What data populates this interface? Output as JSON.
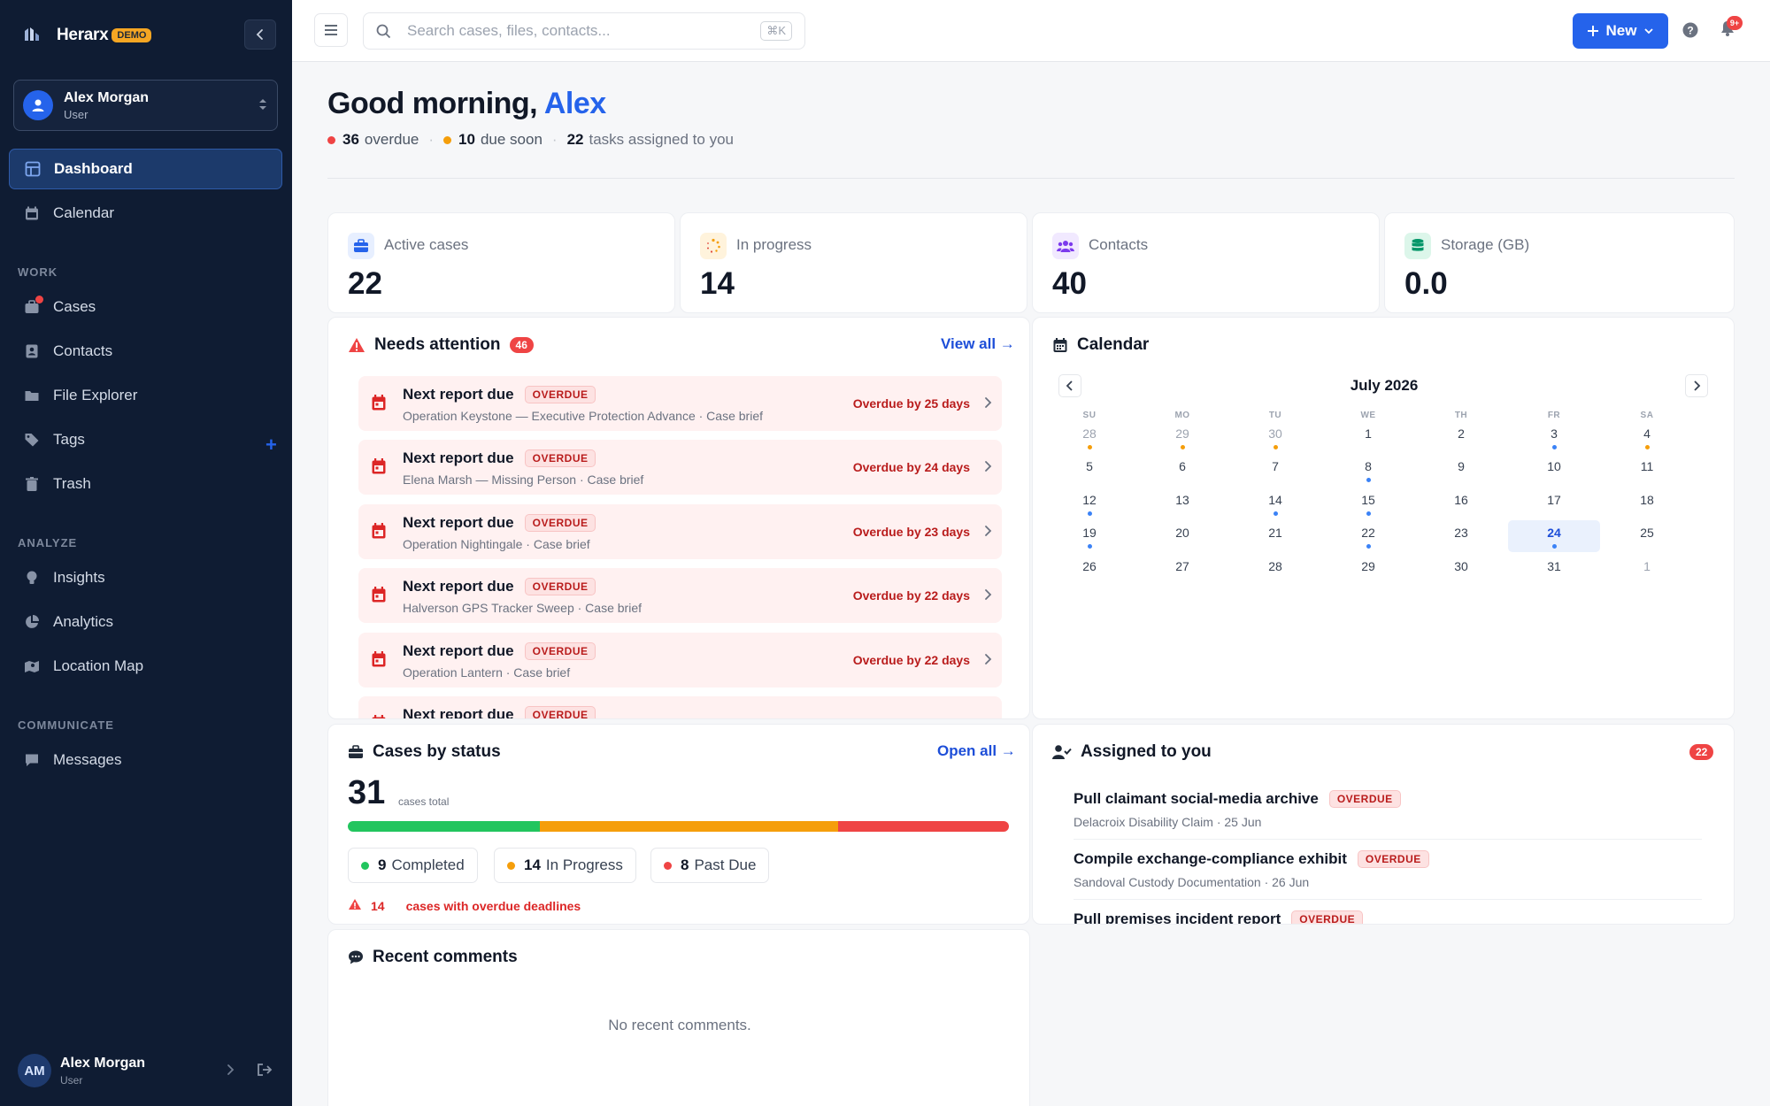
{
  "brand": {
    "name": "Herarx",
    "badge": "DEMO"
  },
  "user_switcher": {
    "name": "Alex Morgan",
    "role": "User"
  },
  "nav": {
    "main": [
      {
        "label": "Dashboard",
        "icon": "dashboard-icon"
      },
      {
        "label": "Calendar",
        "icon": "calendar-icon"
      }
    ],
    "work_title": "WORK",
    "work": [
      {
        "label": "Cases",
        "icon": "briefcase-icon"
      },
      {
        "label": "Contacts",
        "icon": "contacts-icon"
      },
      {
        "label": "File Explorer",
        "icon": "folder-icon"
      },
      {
        "label": "Tags",
        "icon": "tag-icon"
      },
      {
        "label": "Trash",
        "icon": "trash-icon"
      }
    ],
    "analyze_title": "ANALYZE",
    "analyze": [
      {
        "label": "Insights",
        "icon": "lightbulb-icon"
      },
      {
        "label": "Analytics",
        "icon": "pie-chart-icon"
      },
      {
        "label": "Location Map",
        "icon": "map-icon"
      }
    ],
    "communicate_title": "COMMUNICATE",
    "communicate": [
      {
        "label": "Messages",
        "icon": "message-icon"
      }
    ]
  },
  "footer_user": {
    "initials": "AM",
    "name": "Alex Morgan",
    "role": "User"
  },
  "topbar": {
    "search_placeholder": "Search cases, files, contacts...",
    "shortcut": "⌘K",
    "new_label": "New",
    "notification_count": "9+"
  },
  "greeting": {
    "prefix": "Good morning, ",
    "name": "Alex"
  },
  "summary": {
    "overdue_count": "36",
    "overdue_label": "overdue",
    "due_soon_count": "10",
    "due_soon_label": "due soon",
    "tasks_count": "22",
    "tasks_label": "tasks assigned to you"
  },
  "stats": [
    {
      "label": "Active cases",
      "value": "22",
      "icon": "briefcase-icon",
      "color": "#2563eb"
    },
    {
      "label": "In progress",
      "value": "14",
      "icon": "spinner-icon",
      "color": "#f59e0b"
    },
    {
      "label": "Contacts",
      "value": "40",
      "icon": "contacts-icon",
      "color": "#7c3aed"
    },
    {
      "label": "Storage (GB)",
      "value": "0.0",
      "icon": "database-icon",
      "color": "#059669"
    }
  ],
  "attention": {
    "title": "Needs attention",
    "count": "46",
    "view_all": "View all →",
    "items": [
      {
        "title": "Next report due",
        "badge": "OVERDUE",
        "subtitle": "Operation Keystone — Executive Protection Advance · Case brief",
        "due": "Overdue by 25 days"
      },
      {
        "title": "Next report due",
        "badge": "OVERDUE",
        "subtitle": "Elena Marsh — Missing Person · Case brief",
        "due": "Overdue by 24 days"
      },
      {
        "title": "Next report due",
        "badge": "OVERDUE",
        "subtitle": "Operation Nightingale · Case brief",
        "due": "Overdue by 23 days"
      },
      {
        "title": "Next report due",
        "badge": "OVERDUE",
        "subtitle": "Halverson GPS Tracker Sweep · Case brief",
        "due": "Overdue by 22 days"
      },
      {
        "title": "Next report due",
        "badge": "OVERDUE",
        "subtitle": "Operation Lantern · Case brief",
        "due": "Overdue by 22 days"
      },
      {
        "title": "Next report due",
        "badge": "OVERDUE",
        "subtitle": "",
        "due": ""
      }
    ]
  },
  "calendar": {
    "title": "Calendar",
    "month": "July 2026",
    "weekdays": [
      "SU",
      "MO",
      "TU",
      "WE",
      "TH",
      "FR",
      "SA"
    ],
    "weeks": [
      [
        {
          "d": "28",
          "m": true,
          "dot": "#f59e0b"
        },
        {
          "d": "29",
          "m": true,
          "dot": "#f59e0b"
        },
        {
          "d": "30",
          "m": true,
          "dot": "#f59e0b"
        },
        {
          "d": "1"
        },
        {
          "d": "2"
        },
        {
          "d": "3",
          "dot": "#3b82f6"
        },
        {
          "d": "4",
          "dot": "#f59e0b"
        }
      ],
      [
        {
          "d": "5"
        },
        {
          "d": "6"
        },
        {
          "d": "7"
        },
        {
          "d": "8",
          "dot": "#3b82f6"
        },
        {
          "d": "9"
        },
        {
          "d": "10"
        },
        {
          "d": "11"
        }
      ],
      [
        {
          "d": "12",
          "dot": "#3b82f6"
        },
        {
          "d": "13"
        },
        {
          "d": "14",
          "dot": "#3b82f6"
        },
        {
          "d": "15",
          "dot": "#3b82f6"
        },
        {
          "d": "16"
        },
        {
          "d": "17"
        },
        {
          "d": "18"
        }
      ],
      [
        {
          "d": "19",
          "dot": "#3b82f6"
        },
        {
          "d": "20"
        },
        {
          "d": "21"
        },
        {
          "d": "22",
          "dot": "#3b82f6"
        },
        {
          "d": "23"
        },
        {
          "d": "24",
          "today": true,
          "dot": "#3b82f6"
        },
        {
          "d": "25"
        }
      ],
      [
        {
          "d": "26"
        },
        {
          "d": "27"
        },
        {
          "d": "28"
        },
        {
          "d": "29"
        },
        {
          "d": "30"
        },
        {
          "d": "31"
        },
        {
          "d": "1",
          "m": true
        }
      ]
    ]
  },
  "cases_status": {
    "title": "Cases by status",
    "open_all": "Open all →",
    "total": "31",
    "total_label": "cases total",
    "segments": [
      {
        "label": "Completed",
        "count": "9",
        "value": 9,
        "color": "#22c55e"
      },
      {
        "label": "In Progress",
        "count": "14",
        "value": 14,
        "color": "#f59e0b"
      },
      {
        "label": "Past Due",
        "count": "8",
        "value": 8,
        "color": "#ef4444"
      }
    ],
    "overdue_count": "14",
    "overdue_label": "cases with overdue deadlines"
  },
  "assigned": {
    "title": "Assigned to you",
    "count": "22",
    "items": [
      {
        "title": "Pull claimant social-media archive",
        "badge": "OVERDUE",
        "subtitle": "Delacroix Disability Claim · 25 Jun"
      },
      {
        "title": "Compile exchange-compliance exhibit",
        "badge": "OVERDUE",
        "subtitle": "Sandoval Custody Documentation · 26 Jun"
      },
      {
        "title": "Pull premises incident report",
        "badge": "OVERDUE",
        "subtitle": ""
      }
    ]
  },
  "comments": {
    "title": "Recent comments",
    "empty": "No recent comments."
  }
}
